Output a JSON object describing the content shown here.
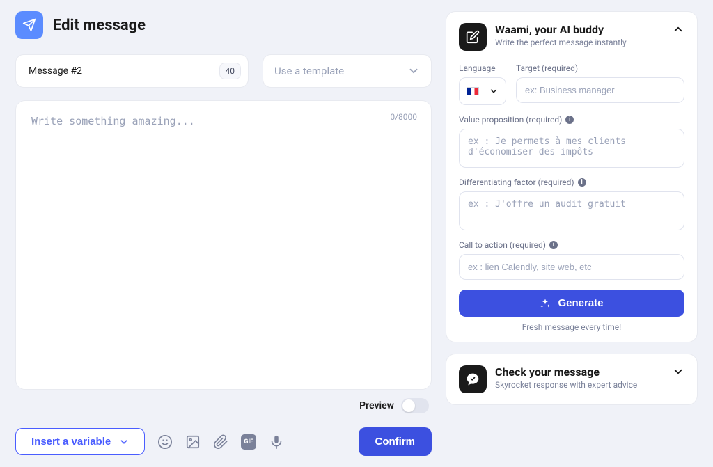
{
  "header": {
    "title": "Edit message"
  },
  "message": {
    "name": "Message #2",
    "length_badge": "40"
  },
  "template_dropdown": {
    "placeholder": "Use a template"
  },
  "editor": {
    "placeholder": "Write something amazing...",
    "counter": "0/8000",
    "value": ""
  },
  "preview": {
    "label": "Preview",
    "enabled": false
  },
  "footer": {
    "insert_variable_label": "Insert a variable",
    "confirm_label": "Confirm",
    "gif_icon_label": "GIF"
  },
  "ai": {
    "title": "Waami, your AI buddy",
    "subtitle": "Write the perfect message instantly",
    "language_label": "Language",
    "target_label": "Target (required)",
    "target_placeholder": "ex: Business manager",
    "value_prop_label": "Value proposition (required)",
    "value_prop_placeholder": "ex : Je permets à mes clients d'économiser des impôts",
    "diff_label": "Differentiating factor (required)",
    "diff_placeholder": "ex : J'offre un audit gratuit",
    "cta_label": "Call to action (required)",
    "cta_placeholder": "ex : lien Calendly, site web, etc",
    "generate_label": "Generate",
    "fresh_message": "Fresh message every time!"
  },
  "check": {
    "title": "Check your message",
    "subtitle": "Skyrocket response with expert advice"
  }
}
